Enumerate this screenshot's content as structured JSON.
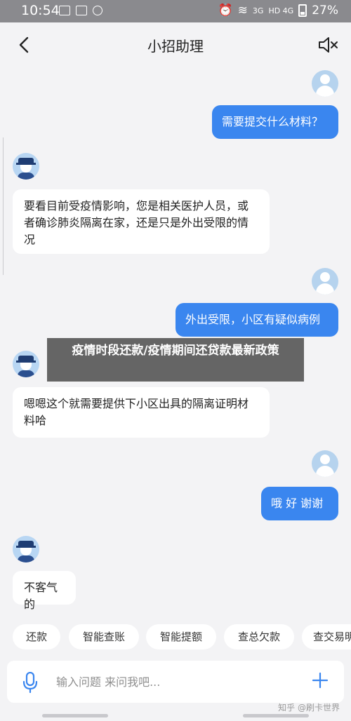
{
  "status": {
    "time": "10:54",
    "signal_1": "3G",
    "signal_2": "HD 4G",
    "battery": "27%"
  },
  "nav": {
    "title": "小招助理"
  },
  "messages": [
    {
      "side": "out",
      "text": "需要提交什么材料？"
    },
    {
      "side": "in",
      "text": "要看目前受疫情影响，您是相关医护人员，或者确诊肺炎隔离在家，还是只是外出受限的情况"
    },
    {
      "side": "out",
      "text": "外出受限，小区有疑似病例"
    },
    {
      "side": "in",
      "text": "嗯嗯这个就需要提供下小区出具的隔离证明材料哈"
    },
    {
      "side": "out",
      "text": "哦 好 谢谢"
    },
    {
      "side": "in",
      "text": "不客气的"
    }
  ],
  "overlay": {
    "title": "疫情时段还款/疫情期间还贷款最新政策"
  },
  "quick_replies": [
    "还款",
    "智能查账",
    "智能提额",
    "查总欠款",
    "查交易明细"
  ],
  "input": {
    "placeholder": "输入问题 来问我吧..."
  },
  "watermark": "知乎 @刷卡世界",
  "colors": {
    "accent": "#3a86ef",
    "background": "#f3f3f5"
  }
}
